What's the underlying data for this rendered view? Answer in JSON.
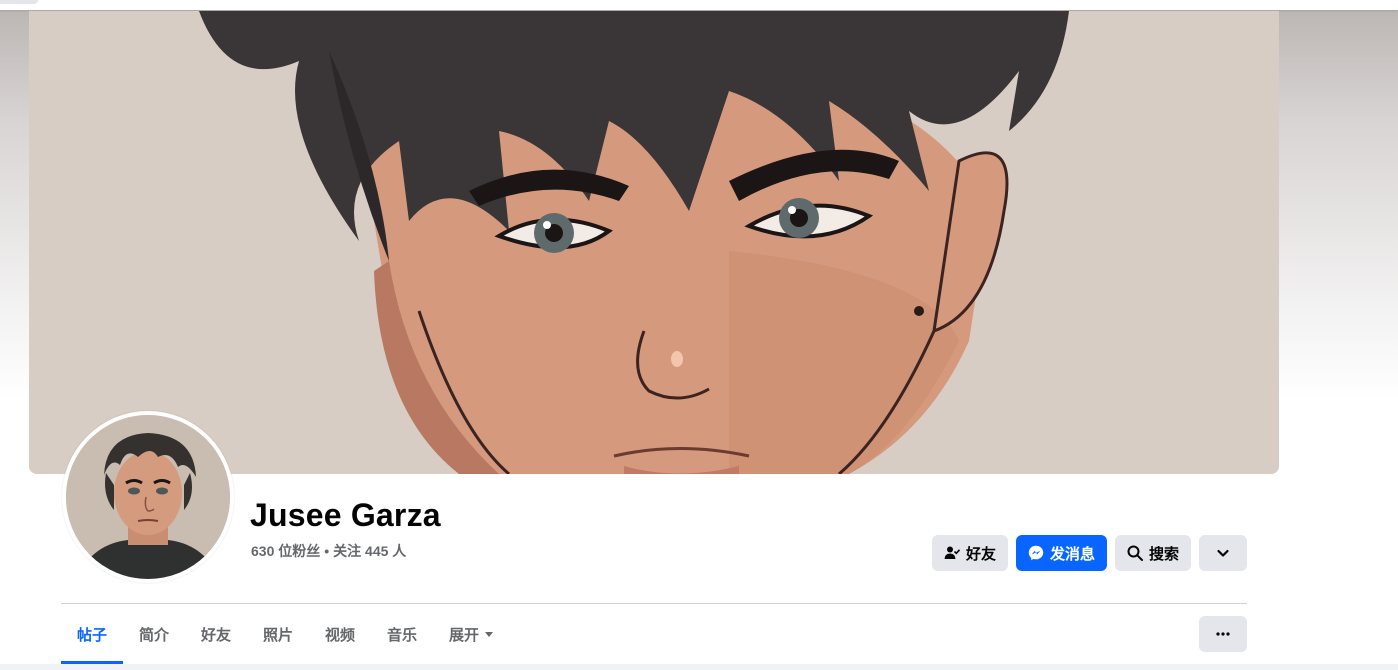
{
  "profile": {
    "name": "Jusee Garza",
    "followers": "630 位粉丝",
    "separator": "•",
    "following": "关注 445 人"
  },
  "actions": {
    "friends_label": "好友",
    "message_label": "发消息",
    "search_label": "搜索"
  },
  "tabs": [
    {
      "label": "帖子",
      "active": true
    },
    {
      "label": "简介",
      "active": false
    },
    {
      "label": "好友",
      "active": false
    },
    {
      "label": "照片",
      "active": false
    },
    {
      "label": "视频",
      "active": false
    },
    {
      "label": "音乐",
      "active": false
    },
    {
      "label": "展开",
      "active": false
    }
  ],
  "icons": {
    "friends": "person-check-icon",
    "message": "messenger-icon",
    "search": "search-icon",
    "expand": "chevron-down-icon",
    "more": "ellipsis-icon",
    "tab_caret": "caret-down-icon"
  },
  "colors": {
    "accent": "#0866ff",
    "button_gray": "#e4e6eb",
    "text_primary": "#050505",
    "text_secondary": "#65676b"
  }
}
